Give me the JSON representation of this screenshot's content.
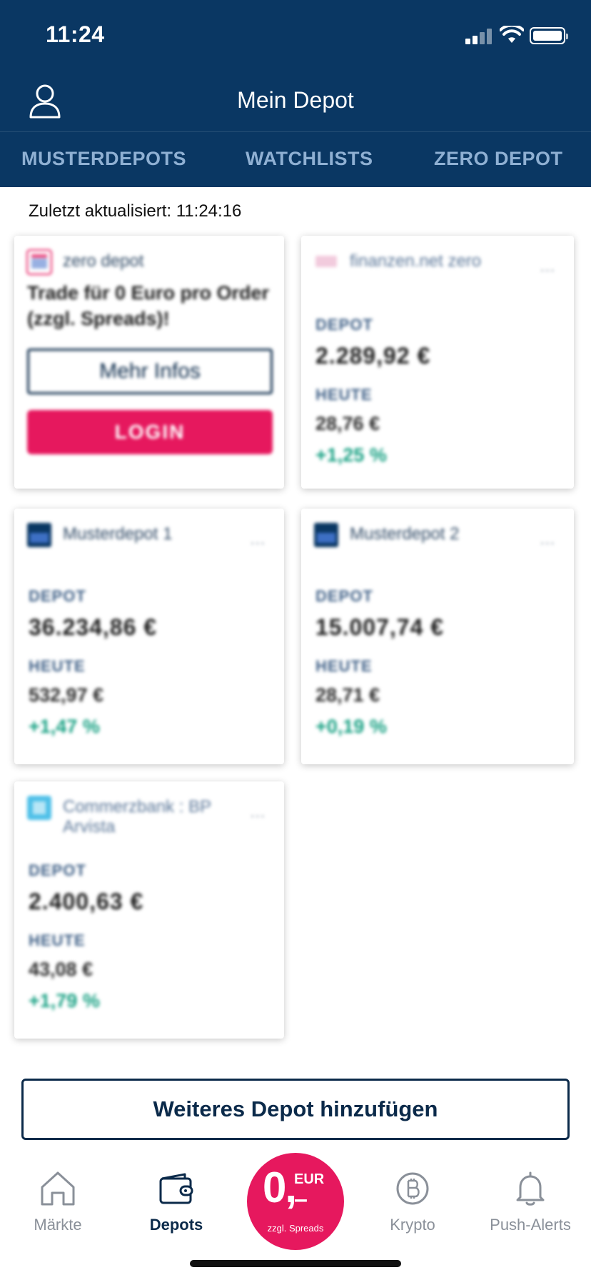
{
  "status_bar": {
    "time": "11:24"
  },
  "nav": {
    "title": "Mein Depot"
  },
  "tabs": [
    {
      "label": "MUSTERDEPOTS"
    },
    {
      "label": "WATCHLISTS"
    },
    {
      "label": "ZERO DEPOT"
    }
  ],
  "last_updated": "Zuletzt aktualisiert: 11:24:16",
  "zero_card": {
    "name": "zero depot",
    "text": "Trade für 0 Euro pro Order (zzgl. Spreads)!",
    "more_info_label": "Mehr Infos",
    "login_label": "LOGIN"
  },
  "depots": [
    {
      "name": "finanzen.net zero",
      "more": "...",
      "depot_label": "DEPOT",
      "depot_value": "2.289,92 €",
      "today_label": "HEUTE",
      "today_value": "28,76 €",
      "change": "+1,25 %"
    },
    {
      "name": "Musterdepot 1",
      "more": "...",
      "depot_label": "DEPOT",
      "depot_value": "36.234,86 €",
      "today_label": "HEUTE",
      "today_value": "532,97 €",
      "change": "+1,47 %"
    },
    {
      "name": "Musterdepot 2",
      "more": "...",
      "depot_label": "DEPOT",
      "depot_value": "15.007,74 €",
      "today_label": "HEUTE",
      "today_value": "28,71 €",
      "change": "+0,19 %"
    },
    {
      "name": "Commerzbank : BP Arvista",
      "more": "...",
      "depot_label": "DEPOT",
      "depot_value": "2.400,63 €",
      "today_label": "HEUTE",
      "today_value": "43,08 €",
      "change": "+1,79 %"
    }
  ],
  "add_depot_label": "Weiteres Depot hinzufügen",
  "bottom_nav": {
    "markte": "Märkte",
    "depots": "Depots",
    "krypto": "Krypto",
    "alerts": "Push-Alerts",
    "promo_zero": "0,",
    "promo_currency": "EUR",
    "promo_dash": "–",
    "promo_sub": "zzgl. Spreads"
  },
  "colors": {
    "header_bg": "#0a3763",
    "accent_pink": "#e6185e",
    "positive_green": "#16a082",
    "text_navy": "#0b2a4a"
  },
  "icons": {
    "profile": "user-icon",
    "markte": "home-icon",
    "depots": "wallet-icon",
    "krypto": "bitcoin-icon",
    "alerts": "bell-icon"
  }
}
